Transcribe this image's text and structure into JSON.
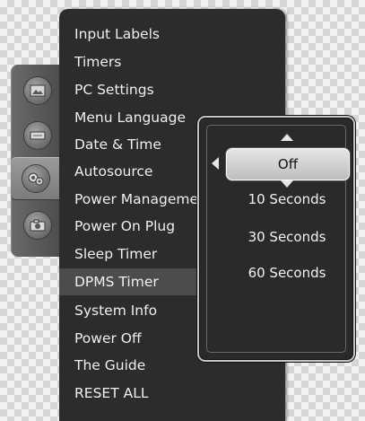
{
  "sidebar": {
    "tabs": [
      {
        "icon": "picture-icon",
        "active": false
      },
      {
        "icon": "sound-icon",
        "active": false
      },
      {
        "icon": "setup-gears-icon",
        "active": true
      },
      {
        "icon": "camera-icon",
        "active": false
      }
    ]
  },
  "menu": {
    "items": [
      {
        "label": "Input Labels"
      },
      {
        "label": "Timers"
      },
      {
        "label": "PC Settings"
      },
      {
        "label": "Menu Language"
      },
      {
        "label": "Date & Time"
      },
      {
        "label": "Autosource"
      },
      {
        "label": "Power Management"
      },
      {
        "label": "Power On Plug"
      },
      {
        "label": "Sleep Timer"
      },
      {
        "label": "DPMS Timer"
      },
      {
        "label": "System Info"
      },
      {
        "label": "Power Off"
      },
      {
        "label": "The Guide"
      },
      {
        "label": "RESET ALL"
      }
    ],
    "selected_item": "DPMS Timer"
  },
  "popup": {
    "selected": "Off",
    "options": [
      "10 Seconds",
      "30 Seconds",
      "60 Seconds"
    ]
  }
}
